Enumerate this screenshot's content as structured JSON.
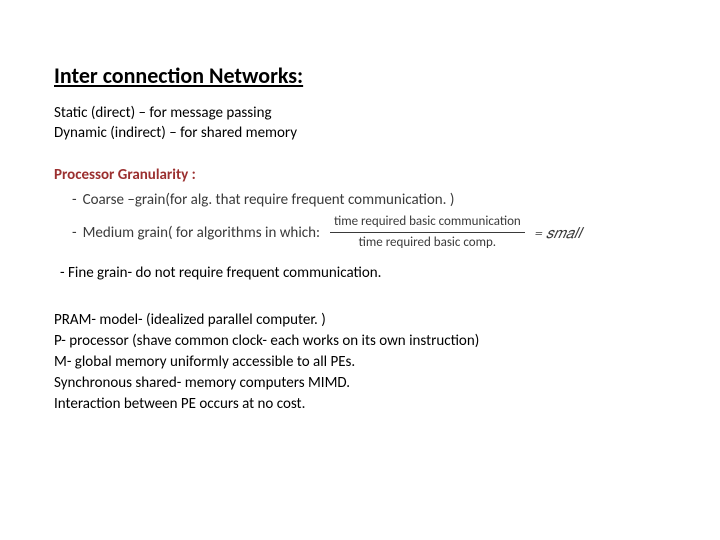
{
  "title": "Inter connection Networks:",
  "intro": {
    "line1": "Static (direct) – for message passing",
    "line2": "Dynamic (indirect) – for shared memory"
  },
  "granularity": {
    "header": "Processor Granularity :",
    "coarse": "Coarse –grain(for alg. that require frequent communication. )",
    "medium_prefix": "Medium grain( for algorithms in which:",
    "fraction_num": "time required basic communication",
    "fraction_den": "time required basic comp.",
    "eq_tail": "= 𝑠𝑚𝑎𝑙𝑙"
  },
  "fine": " - Fine grain- do not require frequent communication.",
  "pram": {
    "l1": "PRAM- model- (idealized parallel computer. )",
    "l2": "P- processor (shave common clock- each works on its own instruction)",
    "l3": "M- global memory uniformly accessible to all PEs.",
    "l4": "Synchronous shared- memory computers MIMD.",
    "l5": "Interaction between PE occurs at no cost."
  }
}
